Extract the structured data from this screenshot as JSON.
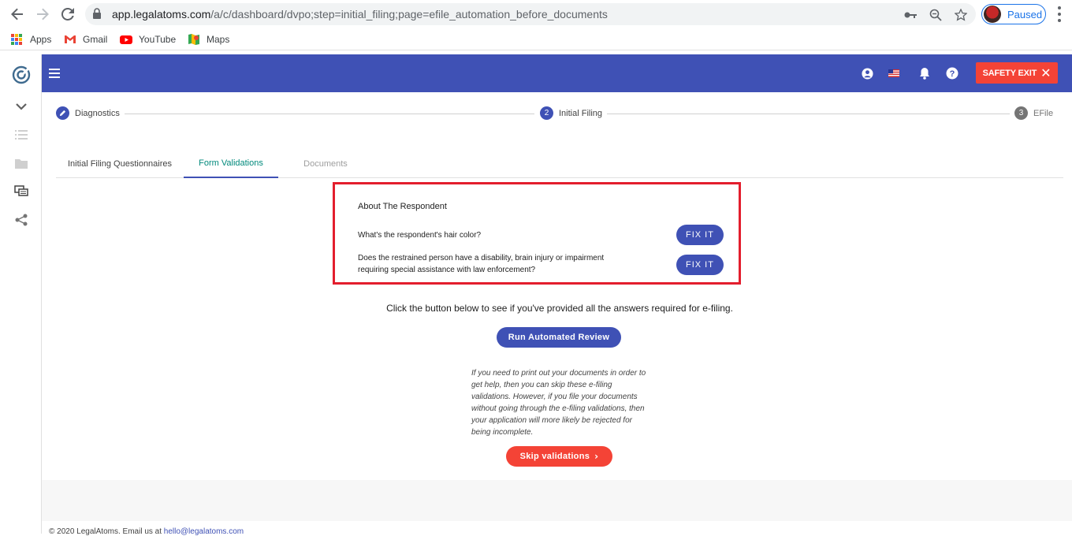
{
  "browser": {
    "url_host": "app.legalatoms.com",
    "url_path": "/a/c/dashboard/dvpo;step=initial_filing;page=efile_automation_before_documents",
    "profile_status": "Paused",
    "bookmarks": [
      {
        "label": "Apps",
        "icon": "apps-grid-icon"
      },
      {
        "label": "Gmail",
        "icon": "gmail-icon"
      },
      {
        "label": "YouTube",
        "icon": "youtube-icon"
      },
      {
        "label": "Maps",
        "icon": "maps-icon"
      }
    ]
  },
  "header": {
    "safety_exit_label": "SAFETY EXIT",
    "icons": [
      "account-circle-icon",
      "us-flag-icon",
      "bell-icon",
      "help-icon"
    ],
    "color": "#3f51b5"
  },
  "sidebar": {
    "icons": [
      "legalatoms-logo-icon",
      "chevron-down-icon",
      "list-icon",
      "folder-icon",
      "chat-icon",
      "share-icon"
    ]
  },
  "stepper": {
    "steps": [
      {
        "marker": "",
        "label": "Diagnostics",
        "state": "done"
      },
      {
        "marker": "2",
        "label": "Initial Filing",
        "state": "active"
      },
      {
        "marker": "3",
        "label": "EFile",
        "state": "pending"
      }
    ]
  },
  "tabs": [
    {
      "label": "Initial Filing Questionnaires",
      "state": "normal"
    },
    {
      "label": "Form Validations",
      "state": "active"
    },
    {
      "label": "Documents",
      "state": "disabled"
    }
  ],
  "validation": {
    "section_title": "About The Respondent",
    "items": [
      {
        "question": "What's the respondent's hair color?",
        "button": "FIX IT"
      },
      {
        "question": "Does the restrained person have a disability, brain injury or impairment requiring special assistance with law enforcement?",
        "button": "FIX IT"
      }
    ],
    "highlight_color": "#e31e2d"
  },
  "review": {
    "instruction": "Click the button below to see if you've provided all the answers required for e-filing.",
    "run_button": "Run Automated Review",
    "skip_note": "If you need to print out your documents in order to get help, then you can skip these e-filing validations. However, if you file your documents without going through the e-filing validations, then your application will more likely be rejected for being incomplete.",
    "skip_button": "Skip validations"
  },
  "footer": {
    "copyright": "© 2020 LegalAtoms.  Email us at",
    "email": "hello@legalatoms.com"
  }
}
